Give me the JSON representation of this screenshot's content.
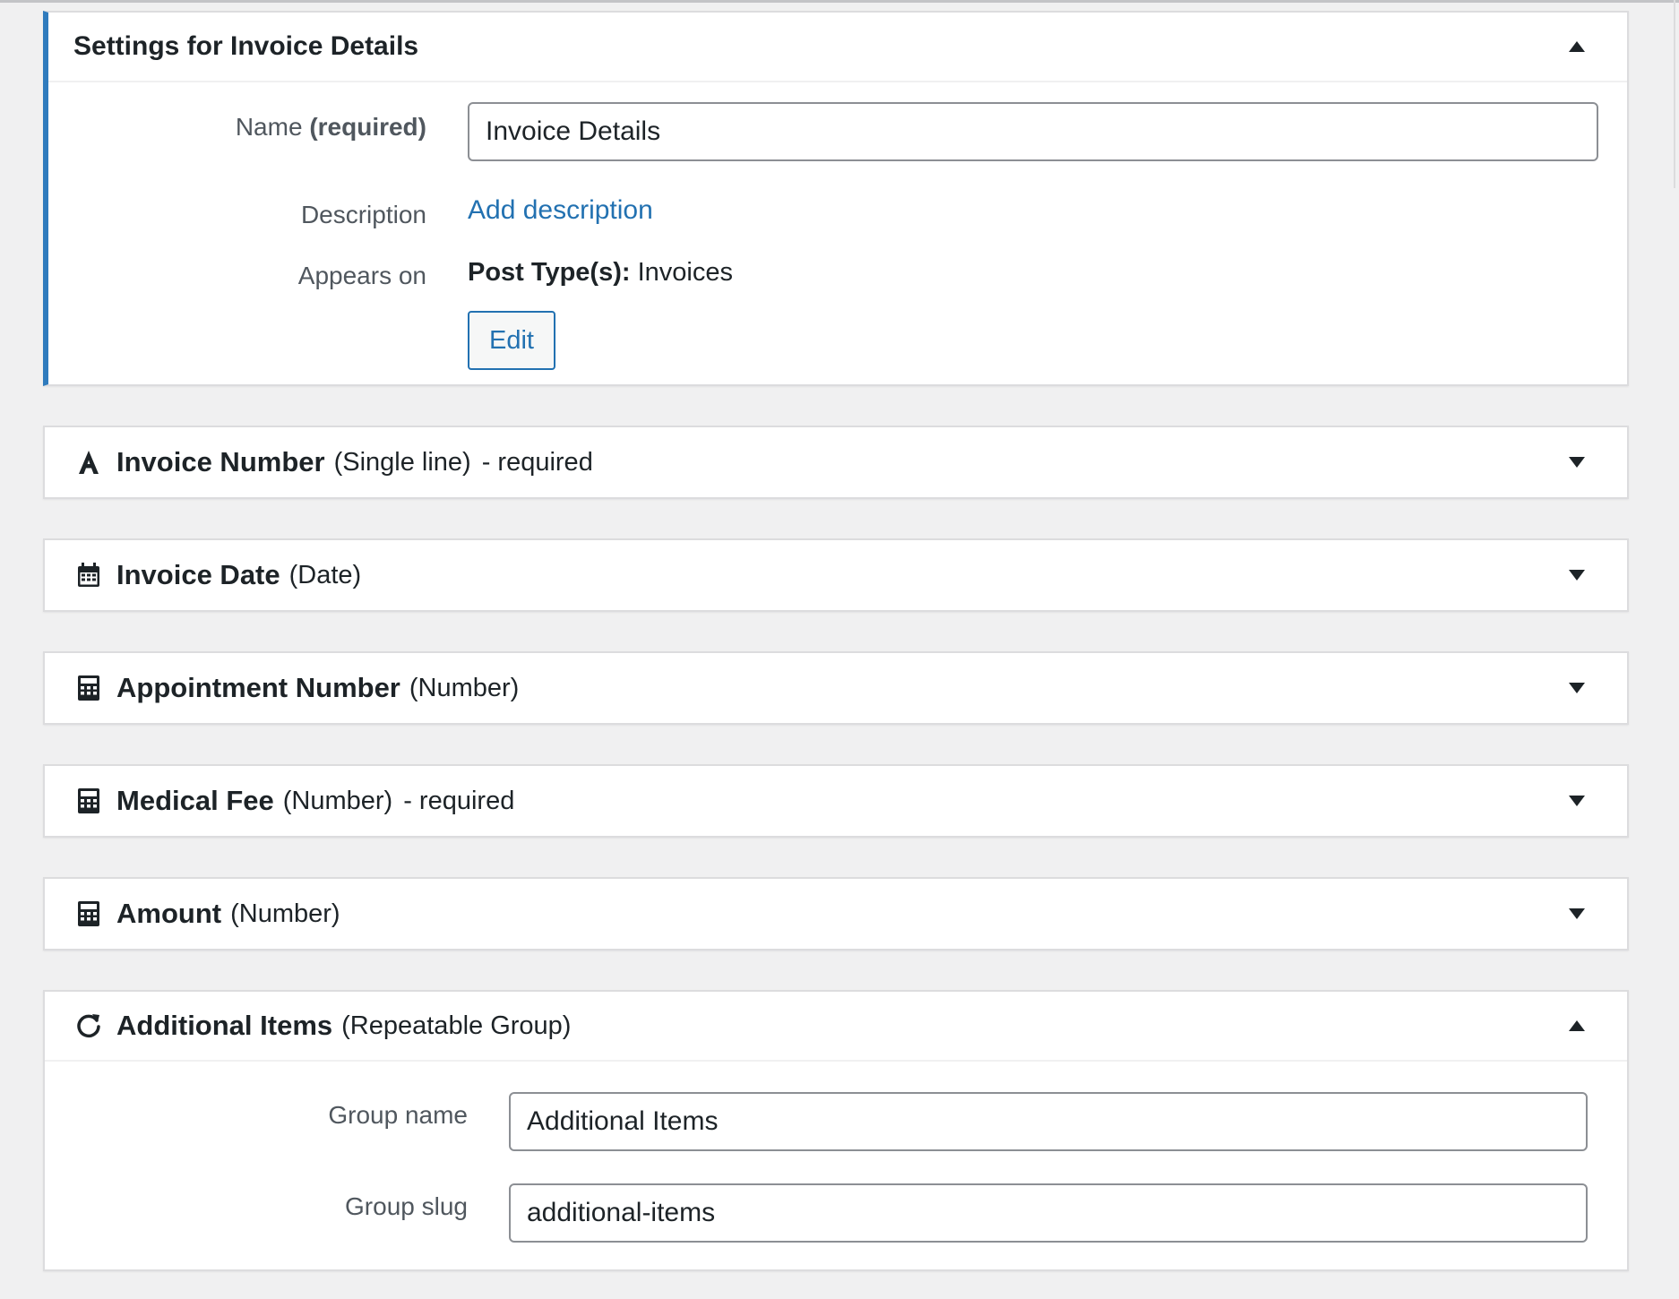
{
  "settings": {
    "title": "Settings for Invoice Details",
    "name_label": "Name",
    "name_required": "(required)",
    "name_value": "Invoice Details",
    "description_label": "Description",
    "add_description": "Add description",
    "appears_on_label": "Appears on",
    "post_types_label": "Post Type(s):",
    "post_types_value": "Invoices",
    "edit_button": "Edit"
  },
  "fields": [
    {
      "name": "Invoice Number",
      "type": "(Single line)",
      "required": "- required",
      "icon": "text-a-icon"
    },
    {
      "name": "Invoice Date",
      "type": "(Date)",
      "required": "",
      "icon": "calendar-icon"
    },
    {
      "name": "Appointment Number",
      "type": "(Number)",
      "required": "",
      "icon": "calculator-icon"
    },
    {
      "name": "Medical Fee",
      "type": "(Number)",
      "required": "- required",
      "icon": "calculator-icon"
    },
    {
      "name": "Amount",
      "type": "(Number)",
      "required": "",
      "icon": "calculator-icon"
    }
  ],
  "group": {
    "name": "Additional Items",
    "type": "(Repeatable Group)",
    "icon": "repeat-icon",
    "group_name_label": "Group name",
    "group_name_value": "Additional Items",
    "group_slug_label": "Group slug",
    "group_slug_value": "additional-items"
  },
  "colors": {
    "accent": "#2f7bbd",
    "link": "#2271b1",
    "background": "#f0f0f1"
  }
}
